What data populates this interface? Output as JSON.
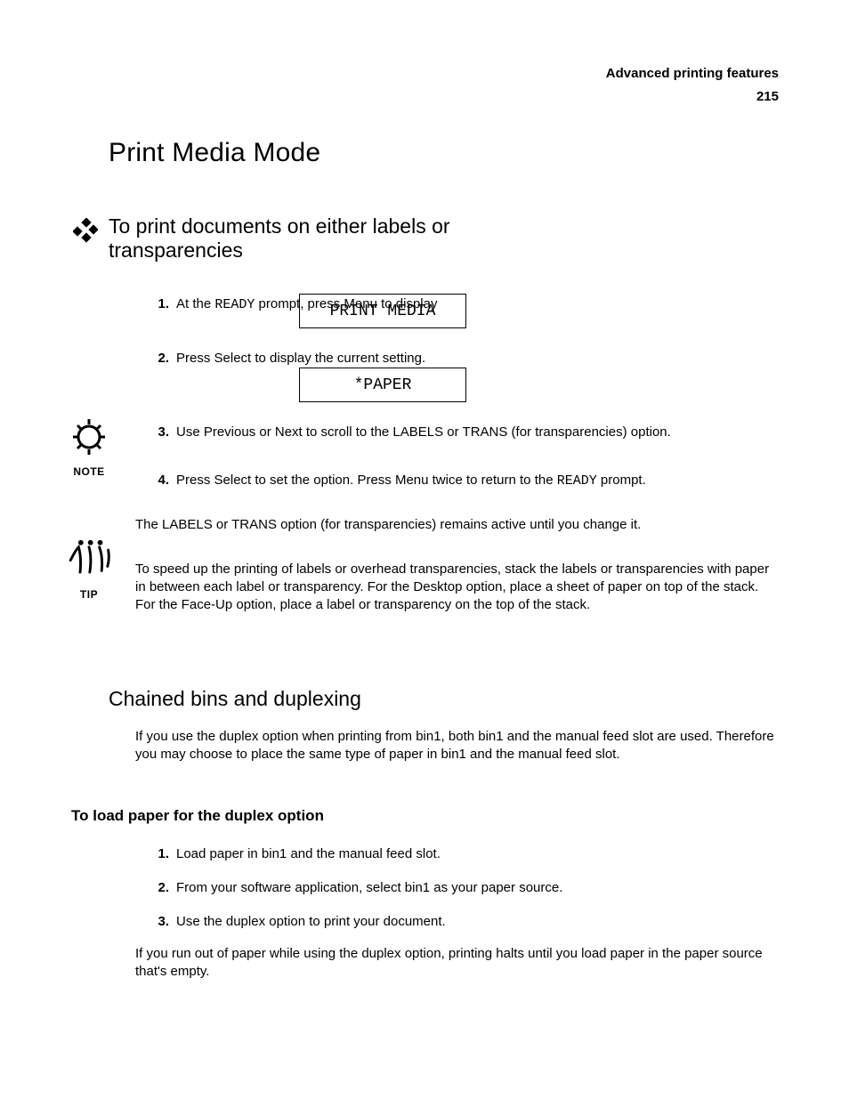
{
  "header": {
    "running_head": "Advanced printing features",
    "page_number": "215"
  },
  "h2": "Print Media Mode",
  "h3_print_media": {
    "line1": "To print documents on either labels or",
    "line2": "transparencies"
  },
  "step1": {
    "num": "1.",
    "text_before": "At the ",
    "mono": "READY",
    "text_after": " prompt, press Menu to display"
  },
  "lcd1": "PRINT MEDIA",
  "step2": {
    "num": "2.",
    "text": "Press Select to display the current setting."
  },
  "lcd2": "*PAPER",
  "step3": {
    "num": "3.",
    "text": "Use Previous or Next to scroll to the LABELS or TRANS (for transparencies) option."
  },
  "step4": {
    "num": "4.",
    "text_before": "Press Select to set the option. Press Menu twice to return to the ",
    "mono": "READY",
    "text_after": " prompt."
  },
  "note": "The LABELS or TRANS option (for transparencies) remains active until you change it.",
  "tip": "To speed up the printing of labels or overhead transparencies, stack the labels or transparencies with paper in between each label or transparency. For the Desktop option, place a sheet of paper on top of the stack. For the Face-Up option, place a label or transparency on the top of the stack.",
  "h3_chained": "Chained bins and duplexing",
  "chained_body": "If you use the duplex option when printing from bin1, both bin1 and the manual feed slot are used. Therefore you may choose to place the same type of paper in bin1 and the manual feed slot.",
  "h4_toload": "To load paper for the duplex option",
  "duplex_step1": {
    "num": "1.",
    "text": "Load paper in bin1 and the manual feed slot."
  },
  "duplex_step2": {
    "num": "2.",
    "text": "From your software application, select bin1 as your paper source."
  },
  "duplex_step3": {
    "num": "3.",
    "text": "Use the duplex option to print your document."
  },
  "duplex_tail": "If you run out of paper while using the duplex option, printing halts until you load paper in the paper source that's empty."
}
